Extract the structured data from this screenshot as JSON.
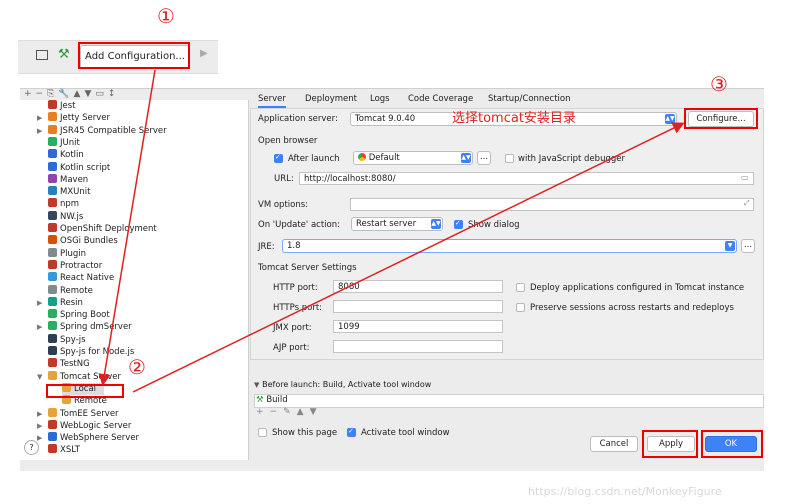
{
  "toolbar": {
    "add_config_label": "Add Configuration..."
  },
  "annotations": {
    "num1": "①",
    "num2": "②",
    "num3": "③",
    "hint": "选择tomcat安装目录"
  },
  "tree": {
    "items": [
      {
        "label": "Jest",
        "color": "#c0392b",
        "arrow": ""
      },
      {
        "label": "Jetty Server",
        "color": "#e67e22",
        "arrow": "▶"
      },
      {
        "label": "JSR45 Compatible Server",
        "color": "#e67e22",
        "arrow": "▶"
      },
      {
        "label": "JUnit",
        "color": "#27ae60",
        "arrow": ""
      },
      {
        "label": "Kotlin",
        "color": "#2c6bd6",
        "arrow": ""
      },
      {
        "label": "Kotlin script",
        "color": "#2c6bd6",
        "arrow": ""
      },
      {
        "label": "Maven",
        "color": "#8e44ad",
        "arrow": ""
      },
      {
        "label": "MXUnit",
        "color": "#2980b9",
        "arrow": ""
      },
      {
        "label": "npm",
        "color": "#c0392b",
        "arrow": ""
      },
      {
        "label": "NW.js",
        "color": "#34495e",
        "arrow": ""
      },
      {
        "label": "OpenShift Deployment",
        "color": "#c0392b",
        "arrow": ""
      },
      {
        "label": "OSGi Bundles",
        "color": "#d35400",
        "arrow": ""
      },
      {
        "label": "Plugin",
        "color": "#7f8c8d",
        "arrow": ""
      },
      {
        "label": "Protractor",
        "color": "#c0392b",
        "arrow": ""
      },
      {
        "label": "React Native",
        "color": "#3498db",
        "arrow": ""
      },
      {
        "label": "Remote",
        "color": "#7f8c8d",
        "arrow": ""
      },
      {
        "label": "Resin",
        "color": "#16a085",
        "arrow": "▶"
      },
      {
        "label": "Spring Boot",
        "color": "#27ae60",
        "arrow": ""
      },
      {
        "label": "Spring dmServer",
        "color": "#27ae60",
        "arrow": "▶"
      },
      {
        "label": "Spy-js",
        "color": "#2c3e50",
        "arrow": ""
      },
      {
        "label": "Spy-js for Node.js",
        "color": "#2c3e50",
        "arrow": ""
      },
      {
        "label": "TestNG",
        "color": "#c0392b",
        "arrow": ""
      },
      {
        "label": "Tomcat Server",
        "color": "#e6a23c",
        "arrow": "▼"
      },
      {
        "label": "Local",
        "color": "#e6a23c",
        "arrow": ""
      },
      {
        "label": "Remote",
        "color": "#e6a23c",
        "arrow": ""
      },
      {
        "label": "TomEE Server",
        "color": "#e6a23c",
        "arrow": "▶"
      },
      {
        "label": "WebLogic Server",
        "color": "#c0392b",
        "arrow": "▶"
      },
      {
        "label": "WebSphere Server",
        "color": "#2c6bd6",
        "arrow": "▶"
      },
      {
        "label": "XSLT",
        "color": "#c0392b",
        "arrow": ""
      }
    ]
  },
  "tabs": [
    "Server",
    "Deployment",
    "Logs",
    "Code Coverage",
    "Startup/Connection"
  ],
  "server": {
    "app_server_label": "Application server:",
    "app_server_value": "Tomcat 9.0.40",
    "configure_label": "Configure...",
    "open_browser_label": "Open browser",
    "after_launch_label": "After launch",
    "browser_value": "Default",
    "dots": "...",
    "js_debugger_label": "with JavaScript debugger",
    "url_label": "URL:",
    "url_value": "http://localhost:8080/",
    "vm_options_label": "VM options:",
    "on_update_label": "On 'Update' action:",
    "on_update_value": "Restart server",
    "show_dialog_label": "Show dialog",
    "jre_label": "JRE:",
    "jre_value": "1.8",
    "tomcat_settings_label": "Tomcat Server Settings",
    "http_port_label": "HTTP port:",
    "http_port_value": "8080",
    "https_port_label": "HTTPs port:",
    "https_port_value": "",
    "jmx_port_label": "JMX port:",
    "jmx_port_value": "1099",
    "ajp_port_label": "AJP port:",
    "ajp_port_value": "",
    "deploy_label": "Deploy applications configured in Tomcat instance",
    "preserve_label": "Preserve sessions across restarts and redeploys",
    "before_launch_label": "Before launch: Build, Activate tool window",
    "build_label": "Build",
    "show_page_label": "Show this page",
    "activate_label": "Activate tool window"
  },
  "buttons": {
    "cancel": "Cancel",
    "apply": "Apply",
    "ok": "OK",
    "help": "?"
  },
  "watermark": "https://blog.csdn.net/MonkeyFigure",
  "colors": {
    "accent": "#3e82f7",
    "annotation_red": "#e02020"
  }
}
